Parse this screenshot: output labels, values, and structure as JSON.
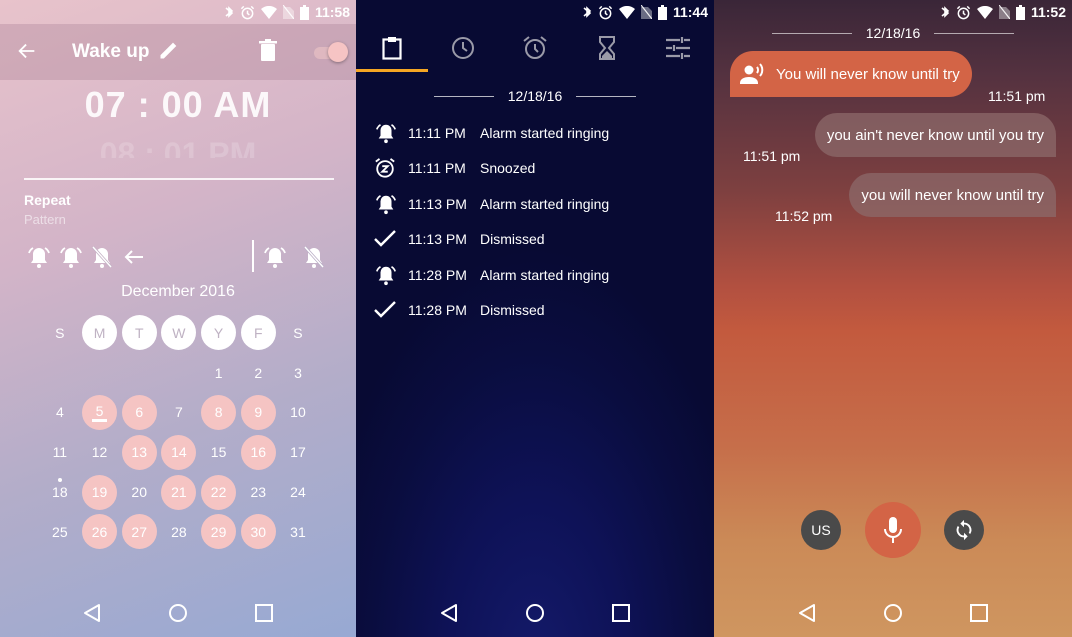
{
  "panels": [
    {
      "status": {
        "time": "11:58",
        "battery_level": "88"
      },
      "toolbar": {
        "title": "Wake up"
      },
      "time_picker": {
        "selected": "07 : 00  AM",
        "next": "08 : 01  PM"
      },
      "repeat": {
        "label": "Repeat",
        "sublabel": "Pattern"
      },
      "calendar": {
        "month_title": "December 2016",
        "weekdays": [
          {
            "label": "S",
            "active": false
          },
          {
            "label": "M",
            "active": true
          },
          {
            "label": "T",
            "active": true
          },
          {
            "label": "W",
            "active": true
          },
          {
            "label": "Y",
            "active": true
          },
          {
            "label": "F",
            "active": true
          },
          {
            "label": "S",
            "active": false
          }
        ],
        "weeks": [
          [
            "",
            "",
            "",
            "",
            "1",
            "2",
            "3"
          ],
          [
            "4",
            "5",
            "6",
            "7",
            "8",
            "9",
            "10"
          ],
          [
            "11",
            "12",
            "13",
            "14",
            "15",
            "16",
            "17"
          ],
          [
            "18",
            "19",
            "20",
            "21",
            "22",
            "23",
            "24"
          ],
          [
            "25",
            "26",
            "27",
            "28",
            "29",
            "30",
            "31"
          ]
        ],
        "selected_days": [
          "5",
          "6",
          "8",
          "9",
          "13",
          "14",
          "16",
          "19",
          "21",
          "22",
          "26",
          "27",
          "29",
          "30"
        ],
        "today": "5",
        "marked_day": "18"
      },
      "colors": {
        "selected_day": "#f5c4c3",
        "accent": "#f6c4c4"
      }
    },
    {
      "status": {
        "time": "11:44",
        "battery_level": "91"
      },
      "tabs": [
        {
          "icon": "clipboard-icon",
          "active": true
        },
        {
          "icon": "clock-icon",
          "active": false
        },
        {
          "icon": "alarm-clock-icon",
          "active": false
        },
        {
          "icon": "hourglass-icon",
          "active": false
        },
        {
          "icon": "settings-sliders-icon",
          "active": false
        }
      ],
      "date": "12/18/16",
      "events": [
        {
          "icon": "alarm-ringing-icon",
          "time": "11:11 PM",
          "description": "Alarm started ringing"
        },
        {
          "icon": "snooze-icon",
          "time": "11:11 PM",
          "description": "Snoozed"
        },
        {
          "icon": "alarm-ringing-icon",
          "time": "11:13 PM",
          "description": "Alarm started ringing"
        },
        {
          "icon": "check-icon",
          "time": "11:13 PM",
          "description": "Dismissed"
        },
        {
          "icon": "alarm-ringing-icon",
          "time": "11:28 PM",
          "description": "Alarm started ringing"
        },
        {
          "icon": "check-icon",
          "time": "11:28 PM",
          "description": "Dismissed"
        }
      ],
      "colors": {
        "tab_indicator": "#f5a623"
      }
    },
    {
      "status": {
        "time": "11:52",
        "battery_level": "87"
      },
      "date": "12/18/16",
      "messages": [
        {
          "direction": "incoming",
          "text": "You will never know until try",
          "time": "11:51 pm"
        },
        {
          "direction": "outgoing",
          "text": "you ain't never know until you try",
          "time": "11:51 pm"
        },
        {
          "direction": "outgoing",
          "text": "you will never know until try",
          "time": "11:52 pm"
        }
      ],
      "controls": {
        "language": "US"
      },
      "colors": {
        "incoming_bubble": "#d36446",
        "mic_button": "#d36446",
        "control_button": "#4a4a4a"
      }
    }
  ]
}
